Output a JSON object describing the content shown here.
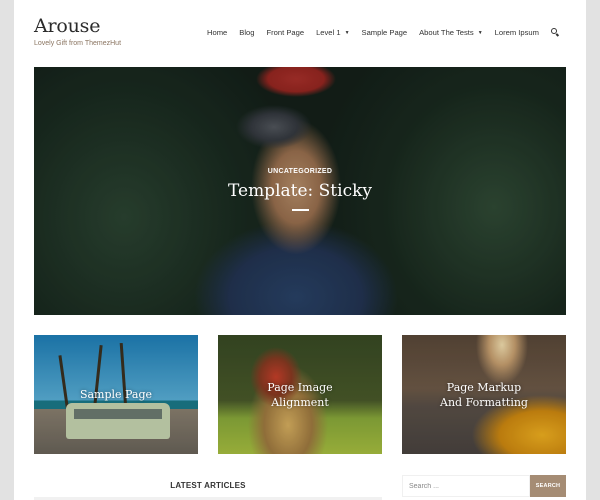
{
  "site": {
    "title": "Arouse",
    "tagline": "Lovely Gift from ThemezHut"
  },
  "nav": {
    "items": [
      {
        "label": "Home",
        "has_dropdown": false
      },
      {
        "label": "Blog",
        "has_dropdown": false
      },
      {
        "label": "Front Page",
        "has_dropdown": false
      },
      {
        "label": "Level 1",
        "has_dropdown": true
      },
      {
        "label": "Sample Page",
        "has_dropdown": false
      },
      {
        "label": "About The Tests",
        "has_dropdown": true
      },
      {
        "label": "Lorem Ipsum",
        "has_dropdown": false
      }
    ],
    "caret": "▼",
    "search_icon": "search-icon"
  },
  "hero": {
    "category": "UNCATEGORIZED",
    "title": "Template: Sticky"
  },
  "cards": [
    {
      "title": "Sample Page"
    },
    {
      "title": "Page Image Alignment"
    },
    {
      "title": "Page Markup And Formatting"
    }
  ],
  "latest": {
    "heading": "LATEST ARTICLES"
  },
  "search": {
    "placeholder": "Search ...",
    "button_label": "SEARCH"
  },
  "colors": {
    "accent": "#a58c74",
    "tagline": "#8a7460",
    "frame": "#e2e2e2"
  }
}
